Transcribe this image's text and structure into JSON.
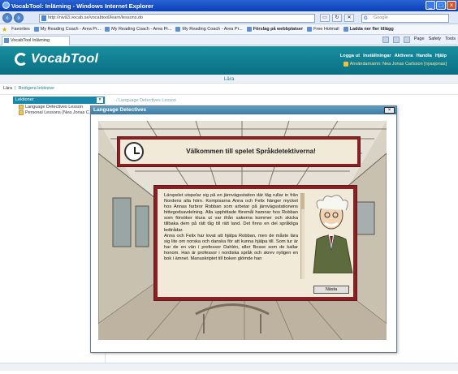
{
  "window": {
    "title": "VocabTool: Inlärning - Windows Internet Explorer",
    "address": "http://nivå3.vocab.se/vocabtool/learn/lessons.do",
    "search_placeholder": "Google"
  },
  "favorites": [
    {
      "label": "Favorites",
      "bold": false
    },
    {
      "label": "My Reading Coach - Area Pr...",
      "bold": false
    },
    {
      "label": "My Reading Coach - Area Pr...",
      "bold": false
    },
    {
      "label": "My Reading Coach - Area Pr...",
      "bold": false
    },
    {
      "label": "Förslag på webbplatser",
      "bold": true
    },
    {
      "label": "Free Hotmail",
      "bold": false
    },
    {
      "label": "Ladda ner fler tillägg",
      "bold": true
    }
  ],
  "tab": {
    "label": "VocabTool Inlärning"
  },
  "commands": [
    "Page",
    "Safety",
    "Tools"
  ],
  "app": {
    "logo": "VocabTool",
    "nav": [
      "Logga ut",
      "Inställningar",
      "Aktivera",
      "Handla",
      "Hjälp"
    ],
    "user": "Användarnamn: Nea Jonas Carlsson [nyasjonas]"
  },
  "section": {
    "title": "Lära"
  },
  "breadcrumb": {
    "root": "Lära",
    "current": "Redigera lektioner"
  },
  "left_panel": {
    "header": "Lektioner",
    "items": [
      "Language Detectives Lesson",
      "Personal Lessons (Nea Jonas C..."
    ]
  },
  "right_header": ": / Language Detectives Lesson",
  "modal": {
    "title": "Language Detectives",
    "close": "×",
    "banner": "Välkommen till spelet Språkdetektiverna!",
    "story": "Lärspelet utspelar sig på en järnvägsstation där tåg rullar in från Nordens alla hörn. Kompisarna Anna och Felix hänger mycket hos Annas farbror Robban som arbetar på järnvägsstationens hittegodsavdelning. Alla upphittade föremål hamnar hos Robban som försöker klura ut var ifrån sakerna kommer och skicka tillbaka dem på rätt tåg till rätt land. Det finns en del språkliga ledtrådar.\nAnna och Felix har lovat att hjälpa Robban, men de måste lära sig lite om norska och danska för att kunna hjälpa till. Som tur är har de en vän i professor Dahlén, eller Bosse som de kallar honom. Han är professor i nordiska språk och skrev nyligen en bok i ämnet. Manuskriptet till boken glömde han",
    "next": "Nästa"
  },
  "colors": {
    "header_teal": "#1888a8",
    "frame_red": "#8b2024",
    "parchment": "#f2ead9"
  }
}
